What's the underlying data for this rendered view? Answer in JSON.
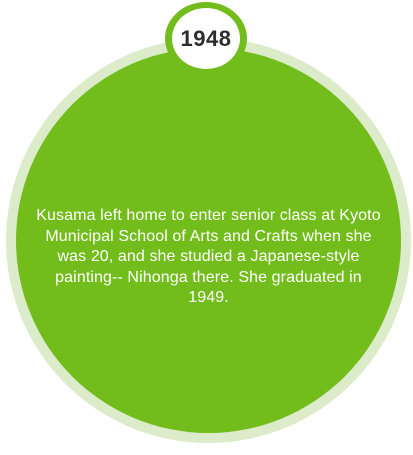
{
  "year": "1948",
  "description": "Kusama left home to enter senior class at Kyoto Municipal School of Arts and Crafts when she was 20, and she studied a Japanese-style painting-- Nihonga there. She graduated in 1949.",
  "colors": {
    "primary_green": "#72bd1c",
    "ring_green": "#dcebc9",
    "badge_background": "#ffffff",
    "year_text": "#2d2d2d",
    "body_text": "#ffffff"
  }
}
